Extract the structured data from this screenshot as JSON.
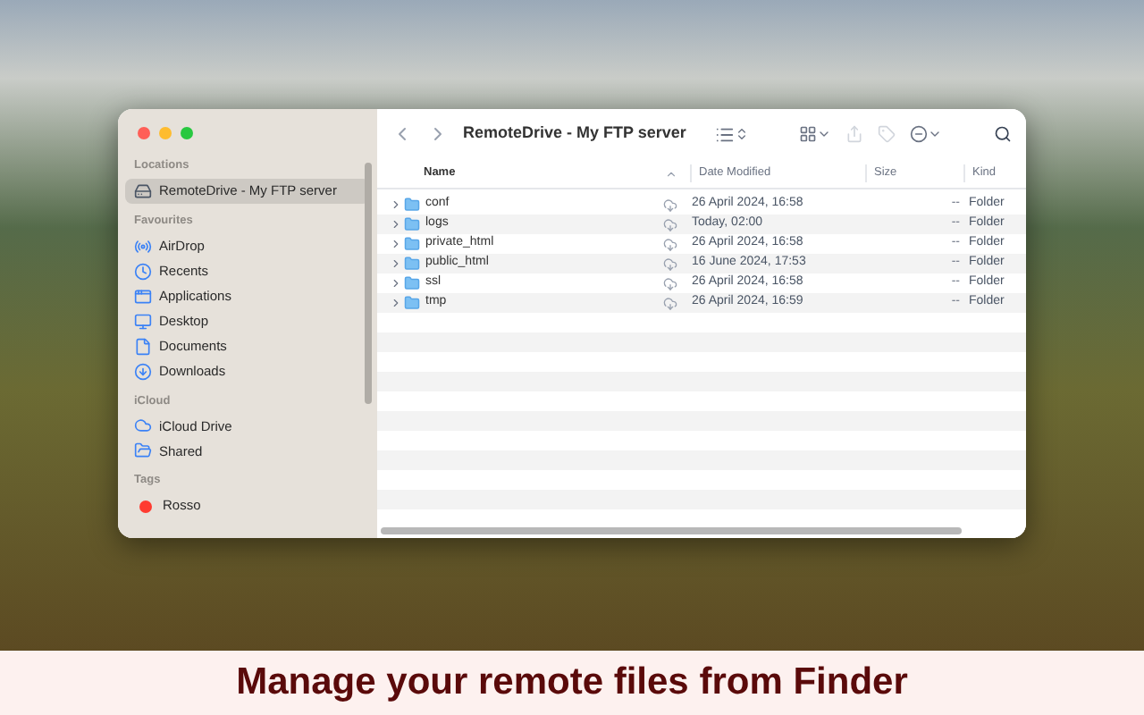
{
  "window": {
    "title": "RemoteDrive - My FTP server"
  },
  "sidebar": {
    "sections": [
      {
        "heading": "Locations",
        "items": [
          {
            "label": "RemoteDrive - My FTP server",
            "kind": "server",
            "selected": true
          }
        ]
      },
      {
        "heading": "Favourites",
        "items": [
          {
            "label": "AirDrop",
            "kind": "airdrop",
            "selected": false
          },
          {
            "label": "Recents",
            "kind": "clock",
            "selected": false
          },
          {
            "label": "Applications",
            "kind": "apps",
            "selected": false
          },
          {
            "label": "Desktop",
            "kind": "desktop",
            "selected": false
          },
          {
            "label": "Documents",
            "kind": "document",
            "selected": false
          },
          {
            "label": "Downloads",
            "kind": "download",
            "selected": false
          }
        ]
      },
      {
        "heading": "iCloud",
        "items": [
          {
            "label": "iCloud Drive",
            "kind": "cloud",
            "selected": false
          },
          {
            "label": "Shared",
            "kind": "shared",
            "selected": false
          }
        ]
      },
      {
        "heading": "Tags",
        "items": [
          {
            "label": "Rosso",
            "kind": "tag",
            "color": "#ff3b30",
            "selected": false
          }
        ]
      }
    ]
  },
  "table": {
    "columns": [
      {
        "label": "Name"
      },
      {
        "label": "Date Modified"
      },
      {
        "label": "Size"
      },
      {
        "label": "Kind"
      }
    ],
    "rows": [
      {
        "name": "conf",
        "date": "26 April 2024, 16:58",
        "size": "--",
        "kind": "Folder"
      },
      {
        "name": "logs",
        "date": "Today, 02:00",
        "size": "--",
        "kind": "Folder"
      },
      {
        "name": "private_html",
        "date": "26 April 2024, 16:58",
        "size": "--",
        "kind": "Folder"
      },
      {
        "name": "public_html",
        "date": "16 June 2024, 17:53",
        "size": "--",
        "kind": "Folder"
      },
      {
        "name": "ssl",
        "date": "26 April 2024, 16:58",
        "size": "--",
        "kind": "Folder"
      },
      {
        "name": "tmp",
        "date": "26 April 2024, 16:59",
        "size": "--",
        "kind": "Folder"
      }
    ]
  },
  "caption": "Manage your remote files from Finder"
}
